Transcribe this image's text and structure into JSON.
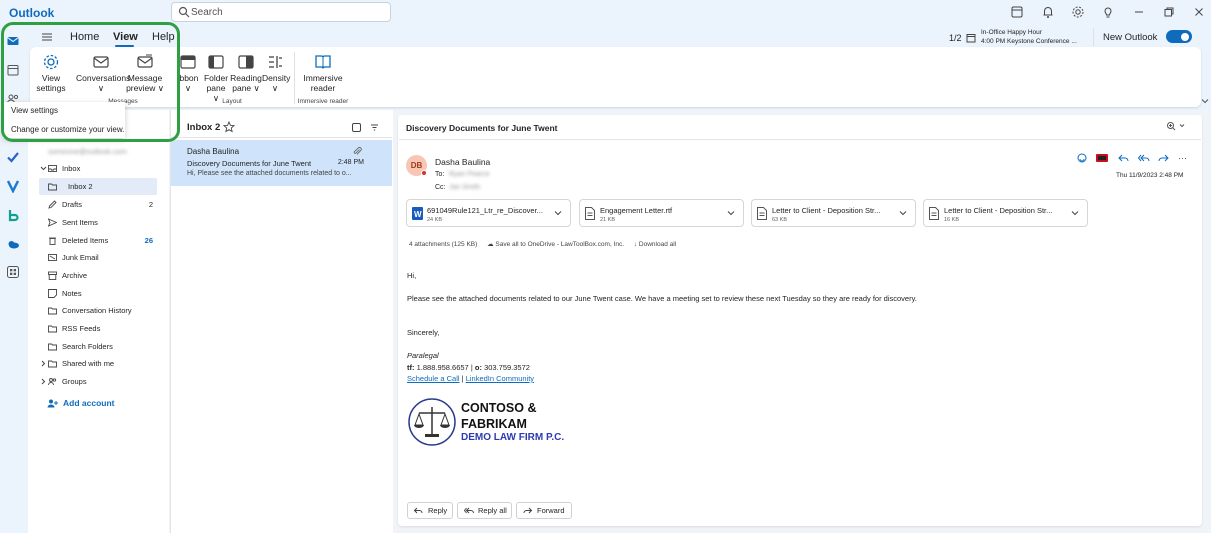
{
  "app": {
    "title": "Outlook"
  },
  "search": {
    "placeholder": "Search"
  },
  "reminder": {
    "counter": "1/2",
    "title": "In-Office Happy Hour",
    "subtitle": "4:00 PM Keystone Conference ..."
  },
  "new_outlook": {
    "label": "New Outlook",
    "enabled": true
  },
  "ribbon": {
    "tabs": [
      "Home",
      "View",
      "Help"
    ],
    "active_tab": "View",
    "buttons": {
      "view_settings": [
        "View",
        "settings"
      ],
      "conversations": [
        "Conversations",
        "∨"
      ],
      "message_preview": [
        "Message",
        "preview ∨"
      ],
      "ribbon": [
        "ibbon",
        "∨"
      ],
      "folder_pane": [
        "Folder",
        "pane ∨"
      ],
      "reading_pane": [
        "Reading",
        "pane ∨"
      ],
      "density": [
        "Density",
        "∨"
      ],
      "immersive_reader": [
        "Immersive",
        "reader"
      ]
    },
    "groups": {
      "layout": "Layout",
      "immersive": "Immersive reader",
      "messages": "Messages"
    }
  },
  "tooltip": {
    "title": "View settings",
    "description": "Change or customize your view."
  },
  "folders": {
    "account": "someone@outlook.com",
    "items": [
      {
        "name": "Inbox",
        "count": ""
      },
      {
        "name": "Inbox 2",
        "count": ""
      },
      {
        "name": "Drafts",
        "count": "2"
      },
      {
        "name": "Sent Items",
        "count": ""
      },
      {
        "name": "Deleted Items",
        "count": "26"
      },
      {
        "name": "Junk Email",
        "count": ""
      },
      {
        "name": "Archive",
        "count": ""
      },
      {
        "name": "Notes",
        "count": ""
      },
      {
        "name": "Conversation History",
        "count": ""
      },
      {
        "name": "RSS Feeds",
        "count": ""
      },
      {
        "name": "Search Folders",
        "count": ""
      },
      {
        "name": "Shared with me",
        "count": ""
      },
      {
        "name": "Groups",
        "count": ""
      }
    ],
    "add_account": "Add account"
  },
  "message_list": {
    "folder_title": "Inbox 2",
    "messages": [
      {
        "sender": "Dasha Baulina",
        "subject": "Discovery Documents for June Twent",
        "time": "2:48 PM",
        "preview": "Hi, Please see the attached documents related to o..."
      }
    ]
  },
  "reading": {
    "subject": "Discovery Documents for June Twent",
    "sender": "Dasha Baulina",
    "initials": "DB",
    "to_label": "To:",
    "cc_label": "Cc:",
    "to_value": "Ryan Pearce",
    "cc_value": "Jan Smith",
    "date": "Thu 11/9/2023 2:48 PM",
    "attachments": [
      {
        "name": "691049Rule121_Ltr_re_Discover...",
        "size": "24 KB",
        "icon": "word-icon"
      },
      {
        "name": "Engagement Letter.rtf",
        "size": "21 KB",
        "icon": "document-icon"
      },
      {
        "name": "Letter to Client - Deposition Str...",
        "size": "63 KB",
        "icon": "document-icon"
      },
      {
        "name": "Letter to Client - Deposition Str...",
        "size": "16 KB",
        "icon": "document-icon"
      }
    ],
    "attachments_summary": "4 attachments (125 KB)",
    "save_onedrive": "Save all to OneDrive - LawToolBox.com, Inc.",
    "download_all": "Download all",
    "greeting": "Hi,",
    "body": "Please see the attached documents related to our June Twent case. We have a meeting set to review these next Tuesday so they are ready for discovery.",
    "signoff": "Sincerely,",
    "sig_title": "Paralegal",
    "sig_tf_label": "tf:",
    "sig_tf": "1.888.958.6657",
    "sig_sep": "|",
    "sig_o_label": "o:",
    "sig_o": "303.759.3572",
    "link_schedule": "Schedule a Call",
    "link_linkedin": "LinkedIn Community",
    "logo_line1": "CONTOSO &",
    "logo_line2": "FABRIKAM",
    "logo_line3": "DEMO LAW FIRM P.C.",
    "actions": {
      "reply": "Reply",
      "reply_all": "Reply all",
      "forward": "Forward"
    }
  },
  "colors": {
    "accent": "#0f6cbd",
    "highlight": "#2ea043",
    "selected": "#cfe4fa"
  }
}
